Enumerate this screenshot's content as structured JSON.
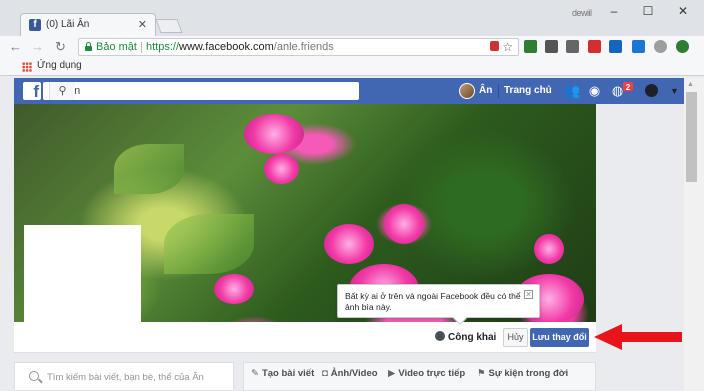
{
  "browser": {
    "tab_title": "(0) Lãi Ân",
    "tab_close": "✕",
    "window_user": "dewiil",
    "window_buttons": [
      "–",
      "☐",
      "✕"
    ],
    "address": {
      "security_label": "Bảo mật",
      "url_proto": "https://",
      "url_host": "www.facebook.com",
      "url_path": "/anle.friends"
    },
    "bookmarks": {
      "apps_label": "Ứng dụng"
    }
  },
  "facebook": {
    "logo": "f",
    "search_value": "Lãi Ân",
    "user_name": "Ân",
    "home_label": "Trang chủ",
    "notification_count": "2"
  },
  "profile": {
    "tooltip_text": "Bất kỳ ai ở trên và ngoài Facebook đều có thể ảnh bìa này.",
    "tooltip_close": "✕",
    "privacy_label": "Công khai",
    "cancel_label": "Hủy",
    "save_label": "Lưu thay đổi"
  },
  "sidebar": {
    "search_placeholder": "Tìm kiếm bài viết, bạn bè, thể của Ân"
  },
  "composer": {
    "items": [
      "Tạo bài viết",
      "Ảnh/Video",
      "Video trực tiếp",
      "Sự kiện trong đời"
    ]
  },
  "colors": {
    "facebook_blue": "#4267b2",
    "secure_green": "#1a8d3b",
    "annotation_red": "#e8141c"
  }
}
